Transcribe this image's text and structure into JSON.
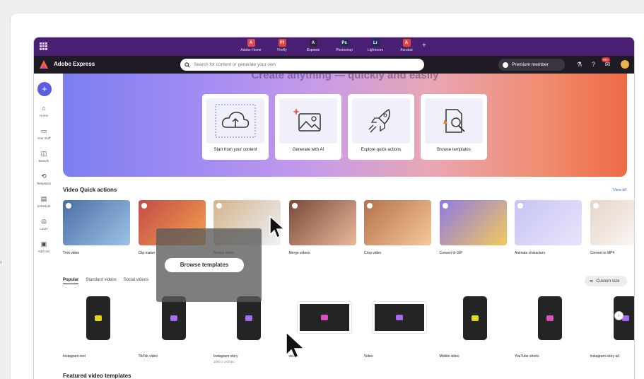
{
  "appbar": {
    "apps": [
      {
        "label": "Adobe Home",
        "icon": "adobe-home-icon",
        "color": "#e34850",
        "glyph": "A"
      },
      {
        "label": "Firefly",
        "icon": "firefly-icon",
        "color": "#e2433c",
        "glyph": "Ff"
      },
      {
        "label": "Express",
        "icon": "express-icon",
        "color": "#2f2340",
        "glyph": "A"
      },
      {
        "label": "Photoshop",
        "icon": "photoshop-icon",
        "color": "#1d2f55",
        "glyph": "Ps"
      },
      {
        "label": "Lightroom",
        "icon": "lightroom-icon",
        "color": "#1d2f55",
        "glyph": "Lr"
      },
      {
        "label": "Acrobat",
        "icon": "acrobat-icon",
        "color": "#e2433c",
        "glyph": "A"
      }
    ]
  },
  "topbar": {
    "brand": "Adobe Express",
    "search_placeholder": "Search for content or generate your own",
    "premium_label": "Premium member",
    "notif_count": "99+"
  },
  "leftnav": {
    "items": [
      {
        "label": "Home",
        "glyph": "⌂"
      },
      {
        "label": "Your stuff",
        "glyph": "▭"
      },
      {
        "label": "Brands",
        "glyph": "◫"
      },
      {
        "label": "Templates",
        "glyph": "⟲"
      },
      {
        "label": "Schedule",
        "glyph": "▤"
      },
      {
        "label": "Learn",
        "glyph": "◎"
      },
      {
        "label": "Add-ons",
        "glyph": "▣"
      }
    ]
  },
  "hero": {
    "title": "Create anything — quickly and easily",
    "cards": [
      {
        "label": "Start from your content"
      },
      {
        "label": "Generate with AI"
      },
      {
        "label": "Explore quick actions"
      },
      {
        "label": "Browse templates"
      }
    ]
  },
  "video_quick_actions": {
    "title": "Video Quick actions",
    "view_all": "View all",
    "items": [
      {
        "label": "Trim video"
      },
      {
        "label": "Clip maker"
      },
      {
        "label": "Resize video"
      },
      {
        "label": "Merge videos"
      },
      {
        "label": "Crop video"
      },
      {
        "label": "Convert to GIF"
      },
      {
        "label": "Animate characters"
      },
      {
        "label": "Convert to MP4"
      }
    ]
  },
  "template_tabs": {
    "tabs": [
      "Popular",
      "Standard videos",
      "Social videos"
    ],
    "active": "Popular",
    "custom_size": "Custom size"
  },
  "templates": [
    {
      "label": "Instagram reel",
      "sub": "",
      "shape": "phone",
      "cam": "#e6d71c"
    },
    {
      "label": "TikTok video",
      "sub": "",
      "shape": "phone",
      "cam": "#a56cf0"
    },
    {
      "label": "Instagram story",
      "sub": "1080 x 1920px",
      "shape": "phone",
      "cam": "#a56cf0"
    },
    {
      "label": "video",
      "sub": "",
      "shape": "wide",
      "cam": "#d94fbf"
    },
    {
      "label": "Video",
      "sub": "",
      "shape": "wide",
      "cam": "#a56cf0"
    },
    {
      "label": "Mobile video",
      "sub": "",
      "shape": "phone",
      "cam": "#e6d71c"
    },
    {
      "label": "YouTube shorts",
      "sub": "",
      "shape": "phone",
      "cam": "#d94fbf"
    },
    {
      "label": "Instagram story ad",
      "sub": "",
      "shape": "phone",
      "cam": "#a56cf0"
    }
  ],
  "overlay": {
    "button_label": "Browse templates"
  },
  "featured": {
    "title": "Featured video templates"
  }
}
